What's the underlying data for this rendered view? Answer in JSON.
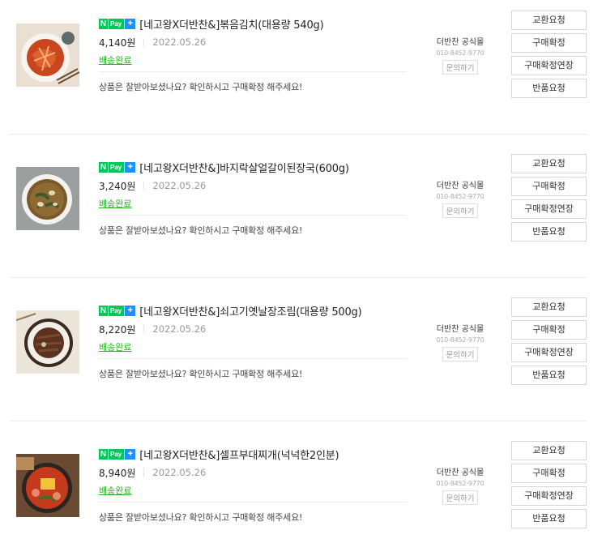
{
  "badge": {
    "n": "N",
    "pay": "Pay",
    "plus": "+"
  },
  "orders": [
    {
      "product_name": "[네고왕X더반찬&]볶음김치(대용량 540g)",
      "price": "4,140원",
      "date": "2022.05.26",
      "status": "배송완료",
      "notice": "상품은 잘받아보셨나요? 확인하시고 구매확정 해주세요!",
      "seller_name": "더반찬 공식몰",
      "seller_phone": "010-8452-9770",
      "inquiry_label": "문의하기",
      "actions": [
        "교환요청",
        "구매확정",
        "구매확정연장",
        "반품요청"
      ]
    },
    {
      "product_name": "[네고왕X더반찬&]바지락살얼갈이된장국(600g)",
      "price": "3,240원",
      "date": "2022.05.26",
      "status": "배송완료",
      "notice": "상품은 잘받아보셨나요? 확인하시고 구매확정 해주세요!",
      "seller_name": "더반찬 공식몰",
      "seller_phone": "010-8452-9770",
      "inquiry_label": "문의하기",
      "actions": [
        "교환요청",
        "구매확정",
        "구매확정연장",
        "반품요청"
      ]
    },
    {
      "product_name": "[네고왕X더반찬&]쇠고기옛날장조림(대용량 500g)",
      "price": "8,220원",
      "date": "2022.05.26",
      "status": "배송완료",
      "notice": "상품은 잘받아보셨나요? 확인하시고 구매확정 해주세요!",
      "seller_name": "더반찬 공식몰",
      "seller_phone": "010-8452-9770",
      "inquiry_label": "문의하기",
      "actions": [
        "교환요청",
        "구매확정",
        "구매확정연장",
        "반품요청"
      ]
    },
    {
      "product_name": "[네고왕X더반찬&]셀프부대찌개(넉넉한2인분)",
      "price": "8,940원",
      "date": "2022.05.26",
      "status": "배송완료",
      "notice": "상품은 잘받아보셨나요? 확인하시고 구매확정 해주세요!",
      "seller_name": "더반찬 공식몰",
      "seller_phone": "010-8452-9770",
      "inquiry_label": "문의하기",
      "actions": [
        "교환요청",
        "구매확정",
        "구매확정연장",
        "반품요청"
      ]
    }
  ],
  "thumbnails": [
    "kimchi-stirfry-photo",
    "doenjang-soup-photo",
    "beef-jangjorim-photo",
    "budae-jjigae-photo"
  ],
  "colors": {
    "npay_green": "#03c75a",
    "npay_plus_blue": "#1e90ff",
    "status_green": "#2ab324"
  }
}
